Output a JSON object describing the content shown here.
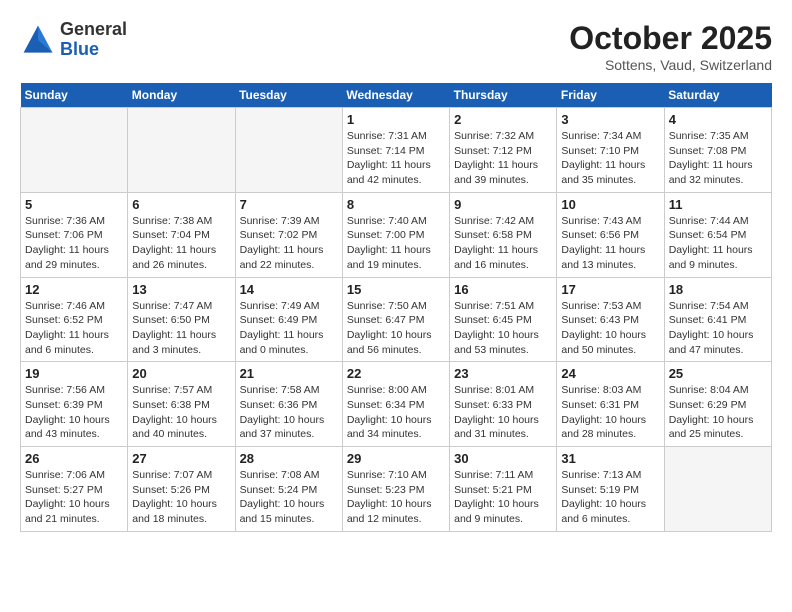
{
  "header": {
    "logo_general": "General",
    "logo_blue": "Blue",
    "month": "October 2025",
    "location": "Sottens, Vaud, Switzerland"
  },
  "days_of_week": [
    "Sunday",
    "Monday",
    "Tuesday",
    "Wednesday",
    "Thursday",
    "Friday",
    "Saturday"
  ],
  "weeks": [
    [
      {
        "day": "",
        "info": ""
      },
      {
        "day": "",
        "info": ""
      },
      {
        "day": "",
        "info": ""
      },
      {
        "day": "1",
        "info": "Sunrise: 7:31 AM\nSunset: 7:14 PM\nDaylight: 11 hours and 42 minutes."
      },
      {
        "day": "2",
        "info": "Sunrise: 7:32 AM\nSunset: 7:12 PM\nDaylight: 11 hours and 39 minutes."
      },
      {
        "day": "3",
        "info": "Sunrise: 7:34 AM\nSunset: 7:10 PM\nDaylight: 11 hours and 35 minutes."
      },
      {
        "day": "4",
        "info": "Sunrise: 7:35 AM\nSunset: 7:08 PM\nDaylight: 11 hours and 32 minutes."
      }
    ],
    [
      {
        "day": "5",
        "info": "Sunrise: 7:36 AM\nSunset: 7:06 PM\nDaylight: 11 hours and 29 minutes."
      },
      {
        "day": "6",
        "info": "Sunrise: 7:38 AM\nSunset: 7:04 PM\nDaylight: 11 hours and 26 minutes."
      },
      {
        "day": "7",
        "info": "Sunrise: 7:39 AM\nSunset: 7:02 PM\nDaylight: 11 hours and 22 minutes."
      },
      {
        "day": "8",
        "info": "Sunrise: 7:40 AM\nSunset: 7:00 PM\nDaylight: 11 hours and 19 minutes."
      },
      {
        "day": "9",
        "info": "Sunrise: 7:42 AM\nSunset: 6:58 PM\nDaylight: 11 hours and 16 minutes."
      },
      {
        "day": "10",
        "info": "Sunrise: 7:43 AM\nSunset: 6:56 PM\nDaylight: 11 hours and 13 minutes."
      },
      {
        "day": "11",
        "info": "Sunrise: 7:44 AM\nSunset: 6:54 PM\nDaylight: 11 hours and 9 minutes."
      }
    ],
    [
      {
        "day": "12",
        "info": "Sunrise: 7:46 AM\nSunset: 6:52 PM\nDaylight: 11 hours and 6 minutes."
      },
      {
        "day": "13",
        "info": "Sunrise: 7:47 AM\nSunset: 6:50 PM\nDaylight: 11 hours and 3 minutes."
      },
      {
        "day": "14",
        "info": "Sunrise: 7:49 AM\nSunset: 6:49 PM\nDaylight: 11 hours and 0 minutes."
      },
      {
        "day": "15",
        "info": "Sunrise: 7:50 AM\nSunset: 6:47 PM\nDaylight: 10 hours and 56 minutes."
      },
      {
        "day": "16",
        "info": "Sunrise: 7:51 AM\nSunset: 6:45 PM\nDaylight: 10 hours and 53 minutes."
      },
      {
        "day": "17",
        "info": "Sunrise: 7:53 AM\nSunset: 6:43 PM\nDaylight: 10 hours and 50 minutes."
      },
      {
        "day": "18",
        "info": "Sunrise: 7:54 AM\nSunset: 6:41 PM\nDaylight: 10 hours and 47 minutes."
      }
    ],
    [
      {
        "day": "19",
        "info": "Sunrise: 7:56 AM\nSunset: 6:39 PM\nDaylight: 10 hours and 43 minutes."
      },
      {
        "day": "20",
        "info": "Sunrise: 7:57 AM\nSunset: 6:38 PM\nDaylight: 10 hours and 40 minutes."
      },
      {
        "day": "21",
        "info": "Sunrise: 7:58 AM\nSunset: 6:36 PM\nDaylight: 10 hours and 37 minutes."
      },
      {
        "day": "22",
        "info": "Sunrise: 8:00 AM\nSunset: 6:34 PM\nDaylight: 10 hours and 34 minutes."
      },
      {
        "day": "23",
        "info": "Sunrise: 8:01 AM\nSunset: 6:33 PM\nDaylight: 10 hours and 31 minutes."
      },
      {
        "day": "24",
        "info": "Sunrise: 8:03 AM\nSunset: 6:31 PM\nDaylight: 10 hours and 28 minutes."
      },
      {
        "day": "25",
        "info": "Sunrise: 8:04 AM\nSunset: 6:29 PM\nDaylight: 10 hours and 25 minutes."
      }
    ],
    [
      {
        "day": "26",
        "info": "Sunrise: 7:06 AM\nSunset: 5:27 PM\nDaylight: 10 hours and 21 minutes."
      },
      {
        "day": "27",
        "info": "Sunrise: 7:07 AM\nSunset: 5:26 PM\nDaylight: 10 hours and 18 minutes."
      },
      {
        "day": "28",
        "info": "Sunrise: 7:08 AM\nSunset: 5:24 PM\nDaylight: 10 hours and 15 minutes."
      },
      {
        "day": "29",
        "info": "Sunrise: 7:10 AM\nSunset: 5:23 PM\nDaylight: 10 hours and 12 minutes."
      },
      {
        "day": "30",
        "info": "Sunrise: 7:11 AM\nSunset: 5:21 PM\nDaylight: 10 hours and 9 minutes."
      },
      {
        "day": "31",
        "info": "Sunrise: 7:13 AM\nSunset: 5:19 PM\nDaylight: 10 hours and 6 minutes."
      },
      {
        "day": "",
        "info": ""
      }
    ]
  ]
}
